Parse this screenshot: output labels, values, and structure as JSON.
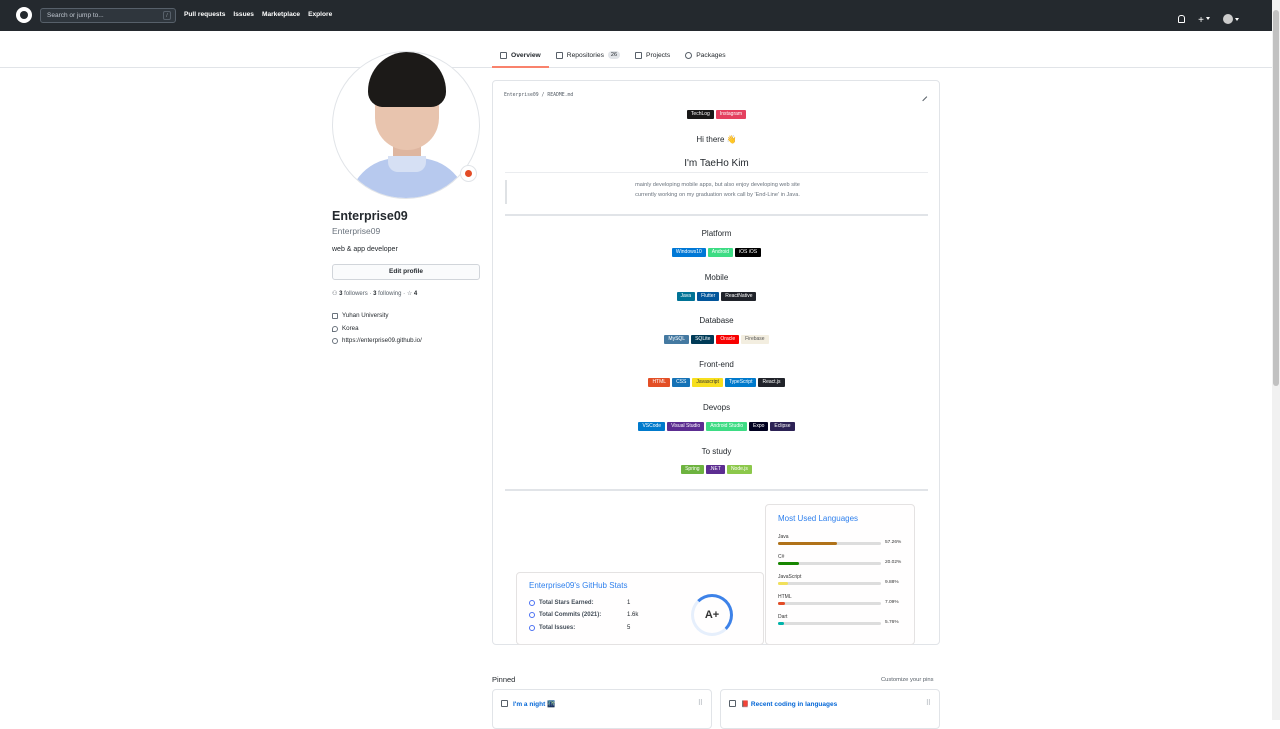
{
  "header": {
    "search_placeholder": "Search or jump to...",
    "search_shortcut": "/",
    "nav": [
      "Pull requests",
      "Issues",
      "Marketplace",
      "Explore"
    ]
  },
  "tabs": [
    {
      "label": "Overview",
      "count": ""
    },
    {
      "label": "Repositories",
      "count": "26"
    },
    {
      "label": "Projects",
      "count": ""
    },
    {
      "label": "Packages",
      "count": ""
    }
  ],
  "profile": {
    "name": "Enterprise09",
    "login": "Enterprise09",
    "bio": "web & app developer",
    "edit_label": "Edit profile",
    "followers": "3",
    "followers_label": "followers",
    "sep": "·",
    "following": "3",
    "following_label": "following",
    "stars": "4",
    "organization": "Yuhan University",
    "location": "Korea",
    "website": "https://enterprise09.github.io/"
  },
  "readme": {
    "path": "Enterprise09 / README.md",
    "social": [
      {
        "label": "TechLog",
        "color": "#181717"
      },
      {
        "label": "Instagram",
        "color": "#E4405F"
      }
    ],
    "greeting": "Hi there 👋",
    "heading": "I'm TaeHo Kim",
    "quote_line1": "mainly developing mobile apps, but also enjoy developing web site",
    "quote_line2": "currently working on my graduation work call by 'End-Line' in Java.",
    "sections": [
      {
        "title": "Platform",
        "badges": [
          {
            "label": "Windows10",
            "color": "#0078D6"
          },
          {
            "label": "Android",
            "color": "#3DDC84"
          },
          {
            "label": "iOS iOS",
            "color": "#000000"
          }
        ]
      },
      {
        "title": "Mobile",
        "badges": [
          {
            "label": "Java",
            "color": "#007396"
          },
          {
            "label": "Flutter",
            "color": "#02569B"
          },
          {
            "label": "ReactNative",
            "color": "#20232A"
          }
        ]
      },
      {
        "title": "Database",
        "badges": [
          {
            "label": "MySQL",
            "color": "#4479A1"
          },
          {
            "label": "SQLite",
            "color": "#003B57"
          },
          {
            "label": "Oracle",
            "color": "#F80000"
          },
          {
            "label": "Firebase",
            "color": "#FFCA28"
          }
        ]
      },
      {
        "title": "Front-end",
        "badges": [
          {
            "label": "HTML",
            "color": "#E34F26"
          },
          {
            "label": "CSS",
            "color": "#1572B6"
          },
          {
            "label": "Javascript",
            "color": "#F7DF1E"
          },
          {
            "label": "TypeScript",
            "color": "#007ACC"
          },
          {
            "label": "React.js",
            "color": "#20232A"
          }
        ]
      },
      {
        "title": "Devops",
        "badges": [
          {
            "label": "VSCode",
            "color": "#007ACC"
          },
          {
            "label": "Visual Studio",
            "color": "#5C2D91"
          },
          {
            "label": "Android Studio",
            "color": "#3DDC84"
          },
          {
            "label": "Expo",
            "color": "#000020"
          },
          {
            "label": "Eclipse",
            "color": "#2C2255"
          }
        ]
      },
      {
        "title": "To study",
        "badges": [
          {
            "label": "Spring",
            "color": "#6DB33F"
          },
          {
            "label": ".NET",
            "color": "#5C2D91"
          },
          {
            "label": "Node.js",
            "color": "#8CC84B"
          }
        ]
      }
    ]
  },
  "stats": {
    "title": "Enterprise09's GitHub Stats",
    "rows": [
      {
        "label": "Total Stars Earned:",
        "value": "1"
      },
      {
        "label": "Total Commits (2021):",
        "value": "1.6k"
      },
      {
        "label": "Total Issues:",
        "value": "5"
      }
    ],
    "grade": "A+"
  },
  "languages": {
    "title": "Most Used Languages",
    "items": [
      {
        "name": "Java",
        "pct": "57.26%",
        "value": 57.26,
        "color": "#b07219"
      },
      {
        "name": "C#",
        "pct": "20.02%",
        "value": 20.02,
        "color": "#178600"
      },
      {
        "name": "JavaScript",
        "pct": "9.88%",
        "value": 9.88,
        "color": "#f1e05a"
      },
      {
        "name": "HTML",
        "pct": "7.09%",
        "value": 7.09,
        "color": "#e34c26"
      },
      {
        "name": "Dart",
        "pct": "5.76%",
        "value": 5.76,
        "color": "#00B4AB"
      }
    ]
  },
  "pinned": {
    "title": "Pinned",
    "customize": "Customize your pins",
    "repos": [
      "I'm a night 🌃",
      "📕 Recent coding in languages"
    ]
  }
}
